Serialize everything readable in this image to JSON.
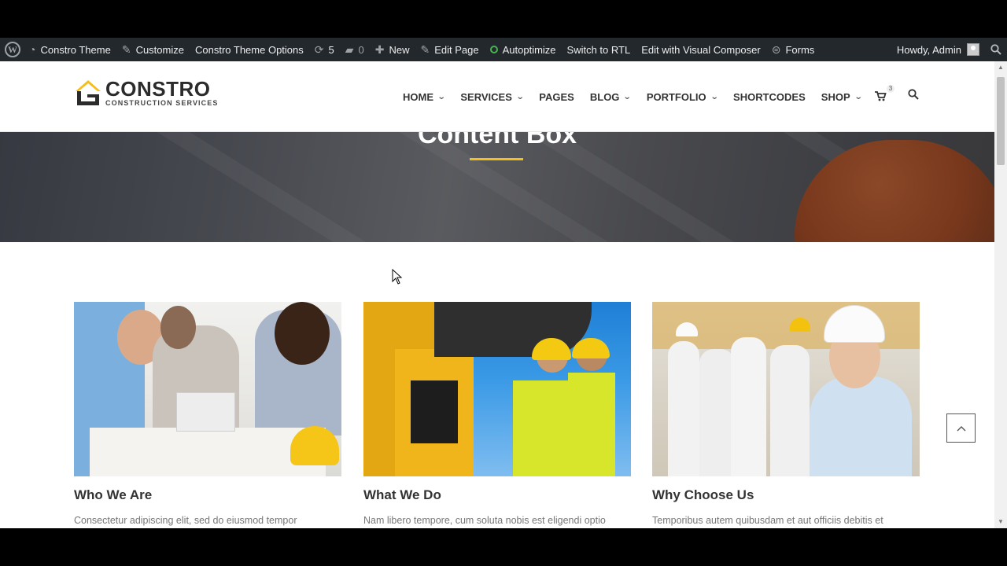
{
  "adminbar": {
    "site_name": "Constro Theme",
    "customize": "Customize",
    "theme_options": "Constro Theme Options",
    "updates_count": "5",
    "comments_count": "0",
    "new": "New",
    "edit_page": "Edit Page",
    "autoptimize": "Autoptimize",
    "switch_rtl": "Switch to RTL",
    "visual_composer": "Edit with Visual Composer",
    "forms": "Forms",
    "howdy": "Howdy, Admin"
  },
  "logo": {
    "title": "CONSTRO",
    "subtitle": "CONSTRUCTION SERVICES"
  },
  "nav": {
    "items": [
      {
        "label": "HOME",
        "dropdown": true
      },
      {
        "label": "SERVICES",
        "dropdown": true
      },
      {
        "label": "PAGES",
        "dropdown": false
      },
      {
        "label": "BLOG",
        "dropdown": true
      },
      {
        "label": "PORTFOLIO",
        "dropdown": true
      },
      {
        "label": "SHORTCODES",
        "dropdown": false
      },
      {
        "label": "SHOP",
        "dropdown": true
      }
    ],
    "cart_count": "3"
  },
  "hero": {
    "title": "Content Box"
  },
  "cards": [
    {
      "title": "Who We Are",
      "text": "Consectetur adipiscing elit, sed do eiusmod tempor"
    },
    {
      "title": "What We Do",
      "text": "Nam libero tempore, cum soluta nobis est eligendi optio"
    },
    {
      "title": "Why Choose Us",
      "text": "Temporibus autem quibusdam et aut officiis debitis et"
    }
  ],
  "colors": {
    "accent": "#f5be1b",
    "adminbar_bg": "#23282d",
    "helmet": "#c24d14"
  }
}
